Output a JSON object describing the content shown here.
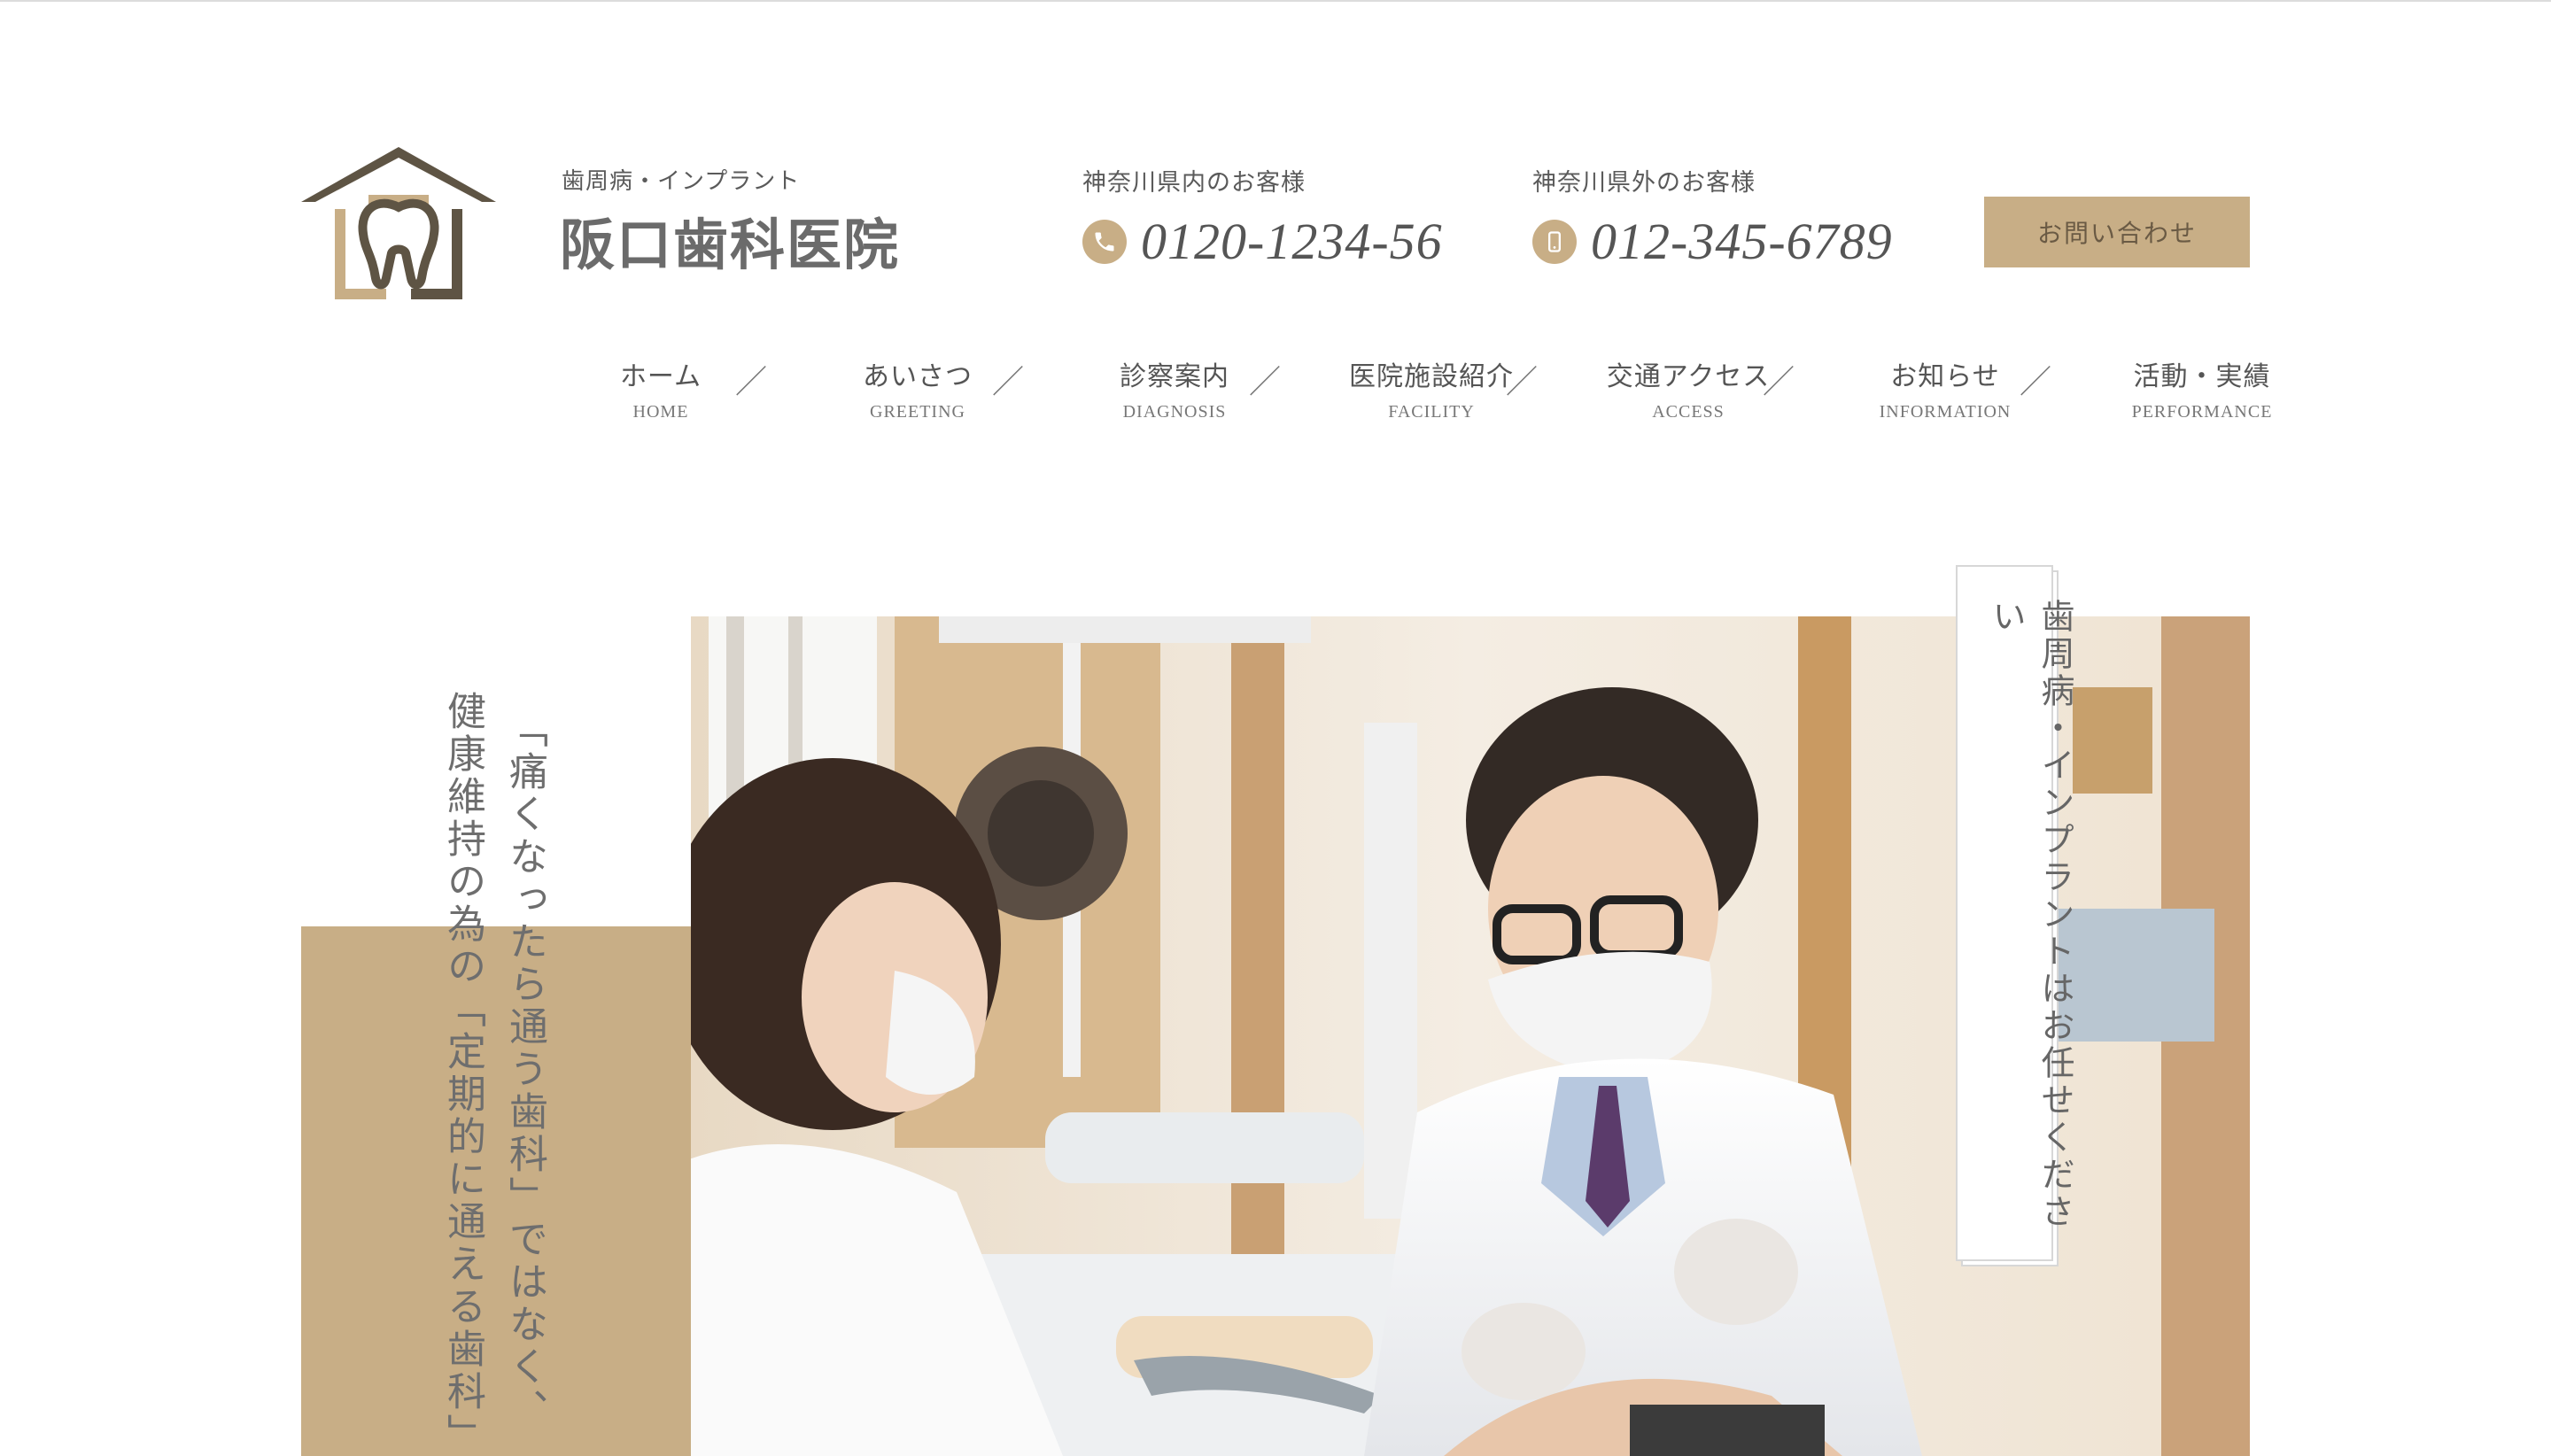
{
  "brand": {
    "subtitle": "歯周病・インプラント",
    "name": "阪口歯科医院",
    "logo_icon": "tooth-house-icon",
    "colors": {
      "accent": "#c8ae86",
      "logo_dark": "#5e5444",
      "text": "#666666"
    }
  },
  "phones": [
    {
      "label": "神奈川県内のお客様",
      "number": "0120-1234-56",
      "icon": "phone-icon"
    },
    {
      "label": "神奈川県外のお客様",
      "number": "012-345-6789",
      "icon": "mobile-phone-icon"
    }
  ],
  "contact_button": {
    "label": "お問い合わせ"
  },
  "nav": {
    "separator": "／",
    "items": [
      {
        "jp": "ホーム",
        "en": "HOME"
      },
      {
        "jp": "あいさつ",
        "en": "GREETING"
      },
      {
        "jp": "診察案内",
        "en": "DIAGNOSIS"
      },
      {
        "jp": "医院施設紹介",
        "en": "FACILITY"
      },
      {
        "jp": "交通アクセス",
        "en": "ACCESS"
      },
      {
        "jp": "お知らせ",
        "en": "INFORMATION"
      },
      {
        "jp": "活動・実績",
        "en": "PERFORMANCE"
      }
    ]
  },
  "hero": {
    "catch_line1": "「痛くなったら通う歯科」ではなく、",
    "catch_line2": "健康維持の為の「定期的に通える歯科」",
    "banner": "歯周病・インプラントはお任せください",
    "photo": "dental-treatment-photo"
  }
}
